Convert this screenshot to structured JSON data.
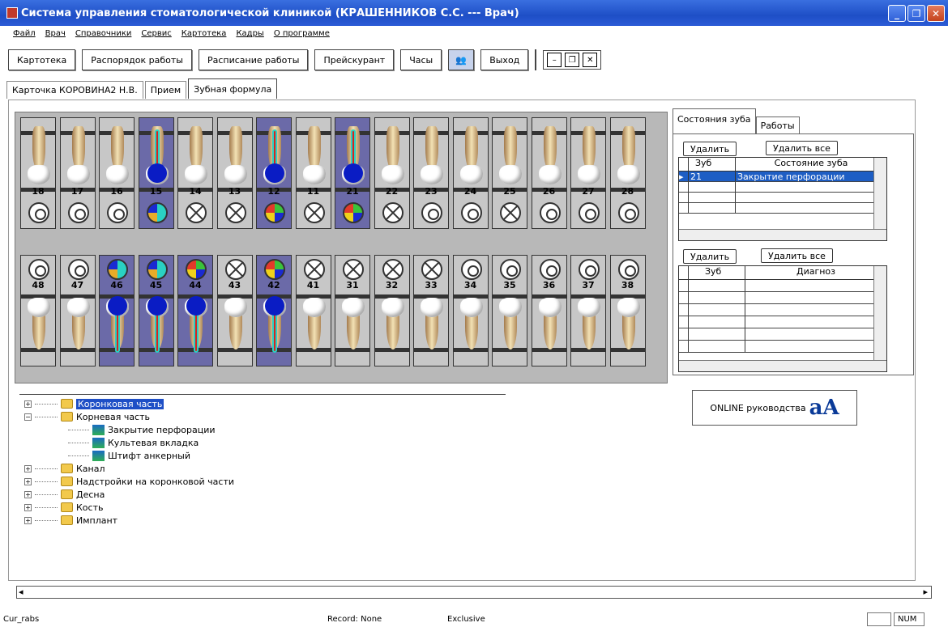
{
  "window": {
    "title": "Система управления стоматологической клиникой (КРАШЕННИКОВ С.С. --- Врач)"
  },
  "menu": [
    "Файл",
    "Врач",
    "Справочники",
    "Сервис",
    "Картотека",
    "Кадры",
    "О программе"
  ],
  "toolbar": {
    "kartoteka": "Картотека",
    "rasporyadok": "Распорядок работы",
    "raspisanie": "Расписание работы",
    "preiskurant": "Прейскурант",
    "chasy": "Часы",
    "vykhod": "Выход"
  },
  "tabs": [
    "Карточка КОРОВИНА2 Н.В.",
    "Прием",
    "Зубная формула"
  ],
  "upper_teeth": [
    {
      "num": "18",
      "selected": false,
      "dial": "ring"
    },
    {
      "num": "17",
      "selected": false,
      "dial": "ring"
    },
    {
      "num": "16",
      "selected": false,
      "dial": "ring"
    },
    {
      "num": "15",
      "selected": true,
      "dial": "color2"
    },
    {
      "num": "14",
      "selected": false,
      "dial": "x"
    },
    {
      "num": "13",
      "selected": false,
      "dial": "x"
    },
    {
      "num": "12",
      "selected": true,
      "dial": "color"
    },
    {
      "num": "11",
      "selected": false,
      "dial": "x"
    },
    {
      "num": "21",
      "selected": true,
      "dial": "color"
    },
    {
      "num": "22",
      "selected": false,
      "dial": "x"
    },
    {
      "num": "23",
      "selected": false,
      "dial": "ring"
    },
    {
      "num": "24",
      "selected": false,
      "dial": "ring"
    },
    {
      "num": "25",
      "selected": false,
      "dial": "x"
    },
    {
      "num": "26",
      "selected": false,
      "dial": "ring"
    },
    {
      "num": "27",
      "selected": false,
      "dial": "ring"
    },
    {
      "num": "28",
      "selected": false,
      "dial": "ring"
    }
  ],
  "lower_teeth": [
    {
      "num": "48",
      "selected": false,
      "dial": "ring"
    },
    {
      "num": "47",
      "selected": false,
      "dial": "ring"
    },
    {
      "num": "46",
      "selected": true,
      "dial": "color2"
    },
    {
      "num": "45",
      "selected": true,
      "dial": "color2"
    },
    {
      "num": "44",
      "selected": true,
      "dial": "color"
    },
    {
      "num": "43",
      "selected": false,
      "dial": "x"
    },
    {
      "num": "42",
      "selected": true,
      "dial": "color"
    },
    {
      "num": "41",
      "selected": false,
      "dial": "x"
    },
    {
      "num": "31",
      "selected": false,
      "dial": "x"
    },
    {
      "num": "32",
      "selected": false,
      "dial": "x"
    },
    {
      "num": "33",
      "selected": false,
      "dial": "x"
    },
    {
      "num": "34",
      "selected": false,
      "dial": "ring"
    },
    {
      "num": "35",
      "selected": false,
      "dial": "ring"
    },
    {
      "num": "36",
      "selected": false,
      "dial": "ring"
    },
    {
      "num": "37",
      "selected": false,
      "dial": "ring"
    },
    {
      "num": "38",
      "selected": false,
      "dial": "ring"
    }
  ],
  "right_panel": {
    "tabs": [
      "Состояния зуба",
      "Работы"
    ],
    "delete": "Удалить",
    "delete_all": "Удалить все",
    "state_grid": {
      "col_tooth": "Зуб",
      "col_state": "Состояние зуба",
      "rows": [
        {
          "tooth": "21",
          "state": "Закрытие перфорации"
        }
      ]
    },
    "delete2": "Удалить",
    "delete_all2": "Удалить все",
    "diag_grid": {
      "col_tooth": "Зуб",
      "col_diag": "Диагноз"
    }
  },
  "online": "ONLINE руководства",
  "tree": [
    {
      "label": "Коронковая часть",
      "level": 0,
      "expanded": false,
      "selected": true
    },
    {
      "label": "Корневая часть",
      "level": 0,
      "expanded": true,
      "selected": false
    },
    {
      "label": "Закрытие перфорации",
      "level": 1
    },
    {
      "label": "Культевая вкладка",
      "level": 1
    },
    {
      "label": "Штифт анкерный",
      "level": 1
    },
    {
      "label": "Канал",
      "level": 0,
      "expanded": false
    },
    {
      "label": "Надстройки на коронковой части",
      "level": 0,
      "expanded": false
    },
    {
      "label": "Десна",
      "level": 0,
      "expanded": false
    },
    {
      "label": "Кость",
      "level": 0,
      "expanded": false
    },
    {
      "label": "Имплант",
      "level": 0,
      "expanded": false
    }
  ],
  "status": {
    "table": "Cur_rabs",
    "record": "Record: None",
    "mode": "Exclusive",
    "num": "NUM"
  }
}
